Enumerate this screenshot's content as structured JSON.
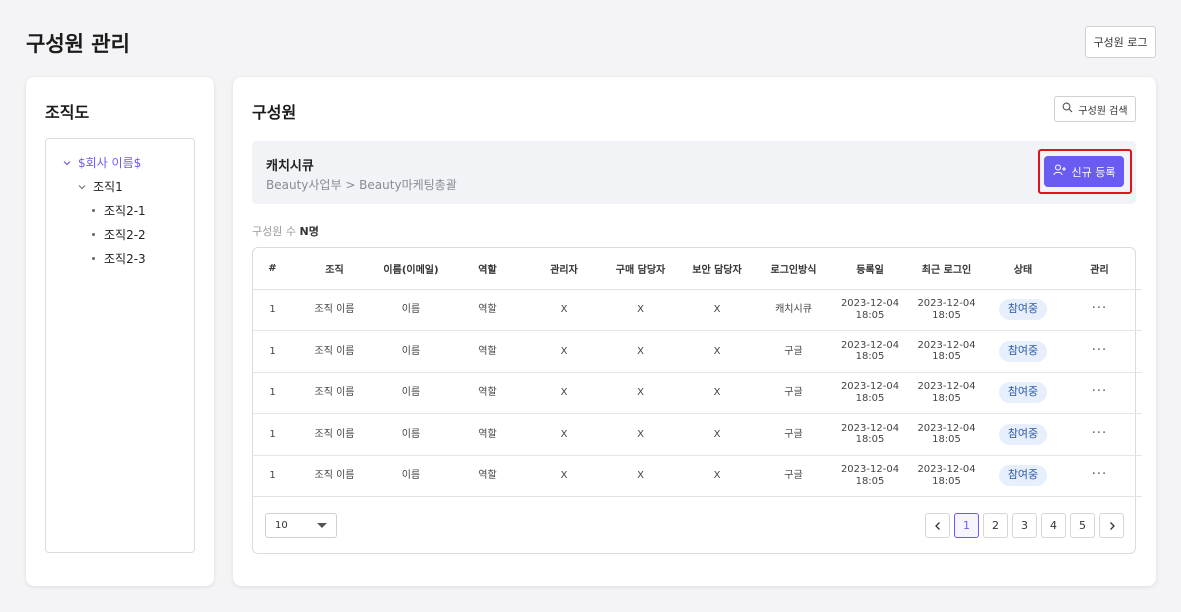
{
  "page": {
    "title": "구성원 관리",
    "log_button": "구성원 로그"
  },
  "org": {
    "title": "조직도",
    "tree": {
      "root": "$회사 이름$",
      "level1": "조직1",
      "level2": [
        "조직2-1",
        "조직2-2",
        "조직2-3"
      ]
    }
  },
  "members": {
    "title": "구성원",
    "search_button": "구성원 검색",
    "info": {
      "name": "캐치시큐",
      "path": "Beauty사업부 > Beauty마케팅총괄"
    },
    "new_button": "신규 등록",
    "count_label": "구성원 수",
    "count_value": "N명",
    "columns": [
      "#",
      "조직",
      "이름(이메일)",
      "역할",
      "관리자",
      "구매 담당자",
      "보안 담당자",
      "로그인방식",
      "등록일",
      "최근 로그인",
      "상태",
      "관리"
    ],
    "rows": [
      {
        "num": "1",
        "org": "조직 이름",
        "name": "이름",
        "role": "역할",
        "admin": "X",
        "purchase": "X",
        "security": "X",
        "login": "캐치시큐",
        "reg_date": "2023-12-04",
        "reg_time": "18:05",
        "last_date": "2023-12-04",
        "last_time": "18:05",
        "status": "참여중",
        "manage": "···"
      },
      {
        "num": "1",
        "org": "조직 이름",
        "name": "이름",
        "role": "역할",
        "admin": "X",
        "purchase": "X",
        "security": "X",
        "login": "구글",
        "reg_date": "2023-12-04",
        "reg_time": "18:05",
        "last_date": "2023-12-04",
        "last_time": "18:05",
        "status": "참여중",
        "manage": "···"
      },
      {
        "num": "1",
        "org": "조직 이름",
        "name": "이름",
        "role": "역할",
        "admin": "X",
        "purchase": "X",
        "security": "X",
        "login": "구글",
        "reg_date": "2023-12-04",
        "reg_time": "18:05",
        "last_date": "2023-12-04",
        "last_time": "18:05",
        "status": "참여중",
        "manage": "···"
      },
      {
        "num": "1",
        "org": "조직 이름",
        "name": "이름",
        "role": "역할",
        "admin": "X",
        "purchase": "X",
        "security": "X",
        "login": "구글",
        "reg_date": "2023-12-04",
        "reg_time": "18:05",
        "last_date": "2023-12-04",
        "last_time": "18:05",
        "status": "참여중",
        "manage": "···"
      },
      {
        "num": "1",
        "org": "조직 이름",
        "name": "이름",
        "role": "역할",
        "admin": "X",
        "purchase": "X",
        "security": "X",
        "login": "구글",
        "reg_date": "2023-12-04",
        "reg_time": "18:05",
        "last_date": "2023-12-04",
        "last_time": "18:05",
        "status": "참여중",
        "manage": "···"
      }
    ],
    "page_size": "10",
    "pages": [
      "1",
      "2",
      "3",
      "4",
      "5"
    ],
    "current_page": "1"
  },
  "colors": {
    "accent": "#6a5cf0",
    "highlight": "#e0121b",
    "status_bg": "#e6effb",
    "status_text": "#2d5aa8"
  }
}
